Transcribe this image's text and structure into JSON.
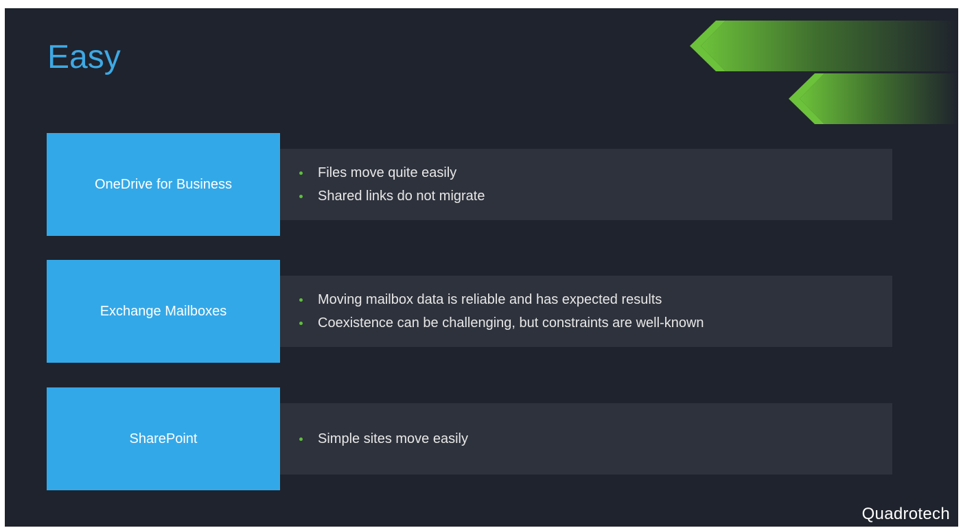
{
  "slide": {
    "title": "Easy",
    "brand": "Quadrotech",
    "colors": {
      "background": "#1f232d",
      "title": "#3ea9e4",
      "label_box": "#33a8e8",
      "panel": "#2e323c",
      "bullet_dot": "#5fbf3c",
      "arrow_green": "#6cc23a"
    },
    "decorations": [
      "chevron-arrow-icon",
      "chevron-arrow-icon"
    ],
    "rows": [
      {
        "label": "OneDrive for Business",
        "bullets": [
          "Files move quite easily",
          "Shared links do not migrate"
        ]
      },
      {
        "label": "Exchange Mailboxes",
        "bullets": [
          "Moving mailbox data is reliable and has expected results",
          "Coexistence can be challenging, but constraints are well-known"
        ]
      },
      {
        "label": "SharePoint",
        "bullets": [
          "Simple sites move easily"
        ]
      }
    ]
  }
}
